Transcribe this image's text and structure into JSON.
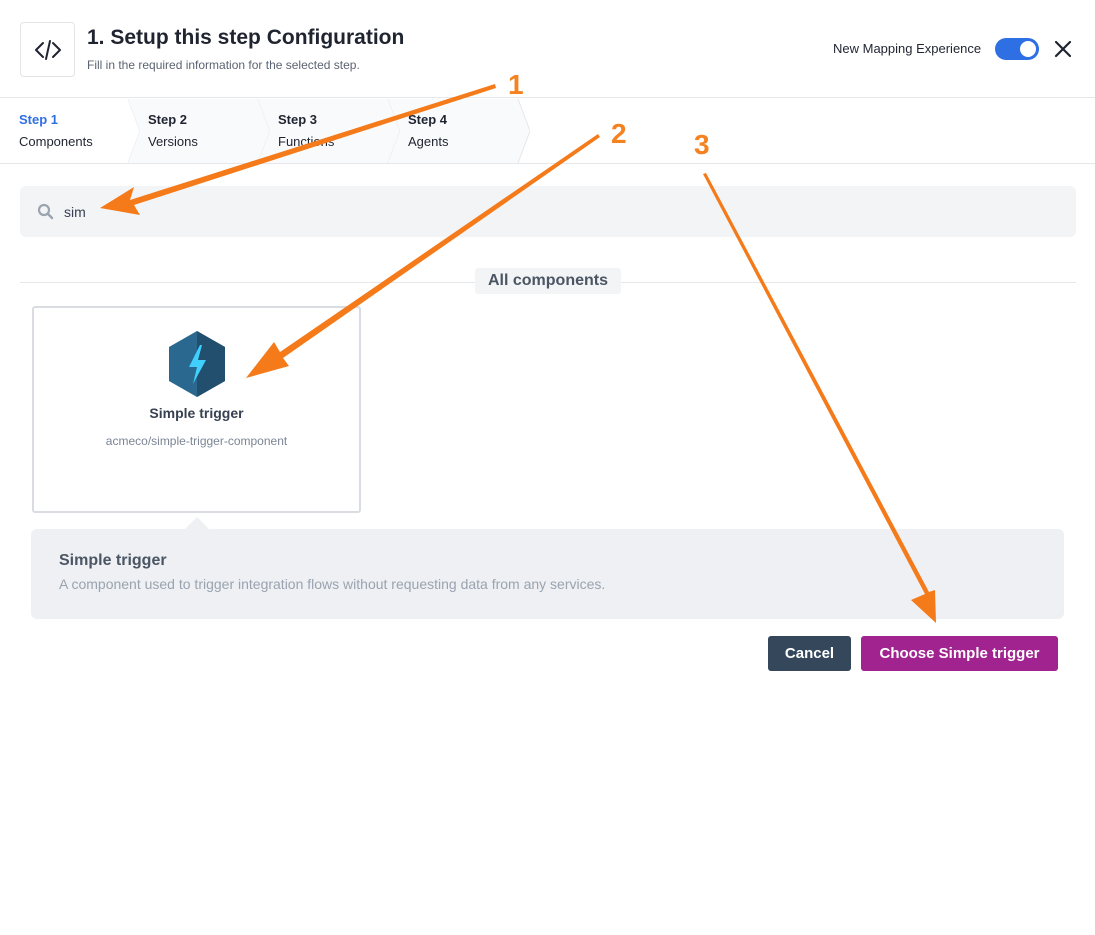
{
  "header": {
    "title": "1. Setup this step Configuration",
    "subtitle": "Fill in the required information for the selected step.",
    "toggle_label": "New Mapping Experience",
    "toggle_on": true,
    "icons": {
      "step_icon": "code-icon",
      "close": "close-icon"
    }
  },
  "steps": [
    {
      "num": "Step 1",
      "name": "Components",
      "active": true
    },
    {
      "num": "Step 2",
      "name": "Versions",
      "active": false
    },
    {
      "num": "Step 3",
      "name": "Functions",
      "active": false
    },
    {
      "num": "Step 4",
      "name": "Agents",
      "active": false
    }
  ],
  "search": {
    "value": "sim",
    "icon": "search-icon"
  },
  "section_label": "All components",
  "card": {
    "title": "Simple trigger",
    "subtitle": "acmeco/simple-trigger-component",
    "icon": "lightning-hexagon-icon"
  },
  "detail": {
    "title": "Simple trigger",
    "description": "A component used to trigger integration flows without requesting data from any services."
  },
  "buttons": {
    "cancel": "Cancel",
    "choose": "Choose Simple trigger"
  },
  "annotations": [
    "1",
    "2",
    "3"
  ],
  "colors": {
    "accent": "#2f6fe4",
    "primary_button": "#a0238f",
    "secondary_button": "#34475b",
    "annotation": "#f58220"
  }
}
